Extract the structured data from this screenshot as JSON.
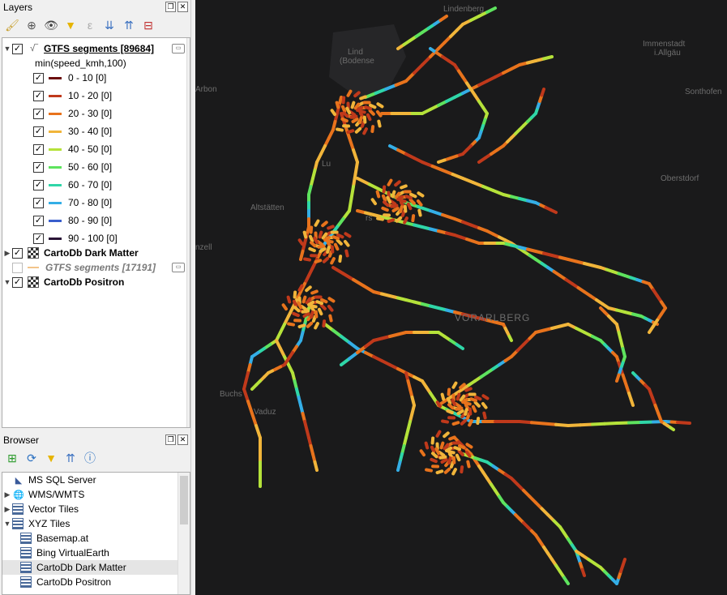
{
  "layers_panel": {
    "title": "Layers",
    "layer1": {
      "name": "GTFS segments [89684]",
      "expression": "min(speed_kmh,100)"
    },
    "legend": [
      {
        "label": "0 - 10 [0]",
        "color": "#6b0f0f"
      },
      {
        "label": "10 - 20 [0]",
        "color": "#c0391b"
      },
      {
        "label": "20 - 30 [0]",
        "color": "#e8731c"
      },
      {
        "label": "30 - 40 [0]",
        "color": "#f1b53a"
      },
      {
        "label": "40 - 50 [0]",
        "color": "#b5e23a"
      },
      {
        "label": "50 - 60 [0]",
        "color": "#5ee35e"
      },
      {
        "label": "60 - 70 [0]",
        "color": "#2fd6a8"
      },
      {
        "label": "70 - 80 [0]",
        "color": "#34aee6"
      },
      {
        "label": "80 - 90 [0]",
        "color": "#3a5fcd"
      },
      {
        "label": "90 - 100 [0]",
        "color": "#2a1436"
      }
    ],
    "layer2": {
      "name": "CartoDb Dark Matter"
    },
    "layer3": {
      "name": "GTFS segments [17191]"
    },
    "layer4": {
      "name": "CartoDb Positron"
    }
  },
  "browser_panel": {
    "title": "Browser",
    "items": [
      {
        "label": "MS SQL Server"
      },
      {
        "label": "WMS/WMTS"
      },
      {
        "label": "Vector Tiles"
      },
      {
        "label": "XYZ Tiles"
      },
      {
        "label": "Basemap.at"
      },
      {
        "label": "Bing VirtualEarth"
      },
      {
        "label": "CartoDb Dark Matter"
      },
      {
        "label": "CartoDb Positron"
      }
    ]
  },
  "map": {
    "labels": {
      "lindenberg": "Lindenberg",
      "lindau1": "Lind",
      "lindau2": "(Bodense",
      "immenstadt1": "Immenstadt",
      "immenstadt2": "i.Allgäu",
      "sonthofen": "Sonthofen",
      "arbon": "Arbon",
      "lustenau": "Lu",
      "oberstdorf": "Oberstdorf",
      "altstatten": "Altstätten",
      "hohenems": "rs",
      "appenzell": "nzell",
      "vorarlberg": "VORARLBERG",
      "buchs": "Buchs",
      "vaduz": "Vaduz"
    }
  }
}
